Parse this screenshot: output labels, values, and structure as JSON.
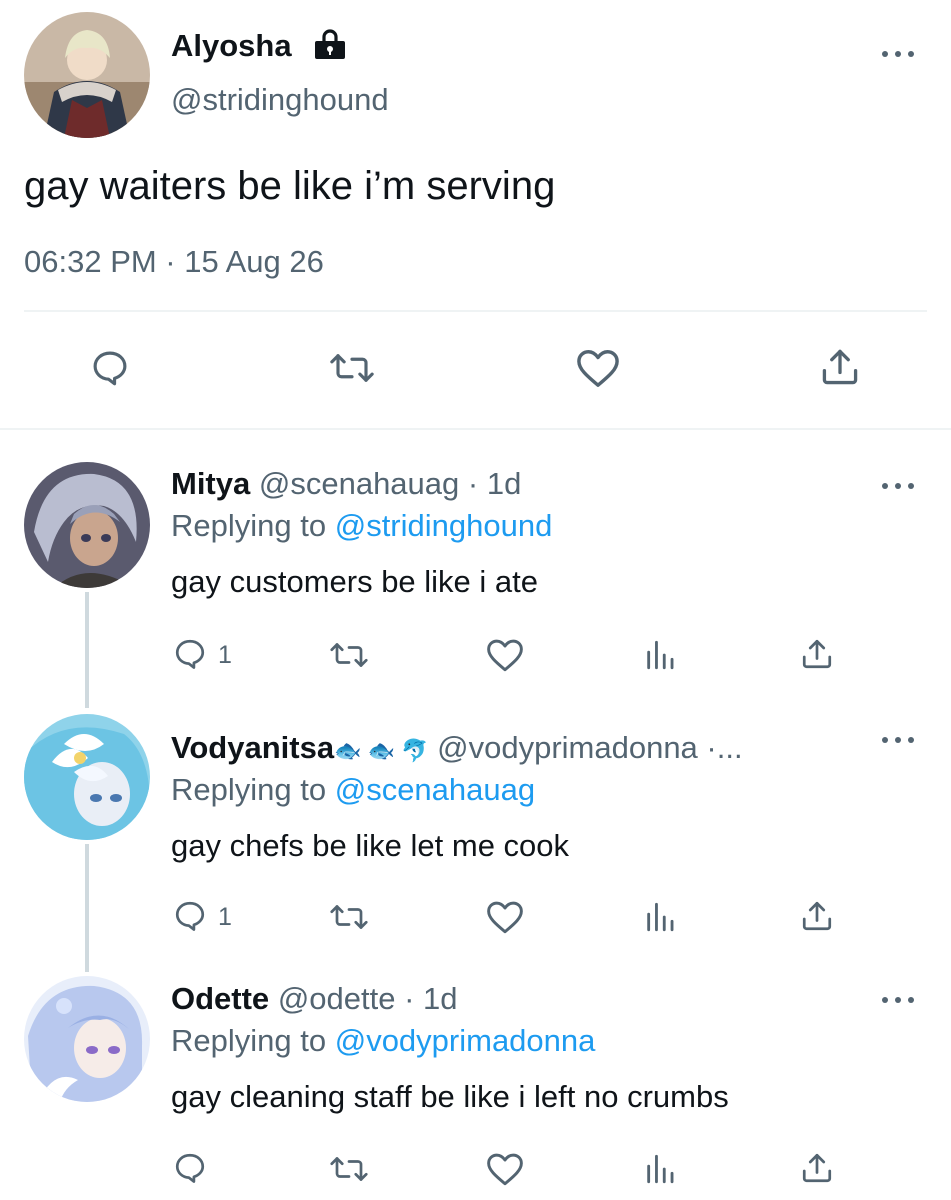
{
  "main_tweet": {
    "display_name": "Alyosha",
    "lock_icon": "lock-icon",
    "handle": "@stridinghound",
    "text": "gay waiters be like i’m serving",
    "timestamp": "06:32 PM · 15 Aug 26",
    "actions": [
      "reply-icon",
      "retweet-icon",
      "like-icon",
      "share-icon"
    ]
  },
  "replies": [
    {
      "display_name": "Mitya",
      "handle": "@scenahauag",
      "meta": " · 1d",
      "replying_prefix": "Replying to ",
      "replying_to": "@stridinghound",
      "text": "gay customers be like i ate",
      "reply_count": "1"
    },
    {
      "display_name": "Vodyanitsa",
      "name_emoji": "🐟 🐟 🐬",
      "handle": "@vodyprimadonna ·...",
      "replying_prefix": "Replying to ",
      "replying_to": "@scenahauag",
      "text": "gay chefs be like let me cook",
      "reply_count": "1"
    },
    {
      "display_name": "Odette",
      "handle": "@odette",
      "meta": " · 1d",
      "replying_prefix": "Replying to ",
      "replying_to": "@vodyprimadonna",
      "text": "gay cleaning staff be like i left no crumbs",
      "reply_count": ""
    }
  ],
  "colors": {
    "text": "#0f1419",
    "secondary": "#536471",
    "link": "#1d9bf0",
    "divider": "#eff3f4"
  }
}
